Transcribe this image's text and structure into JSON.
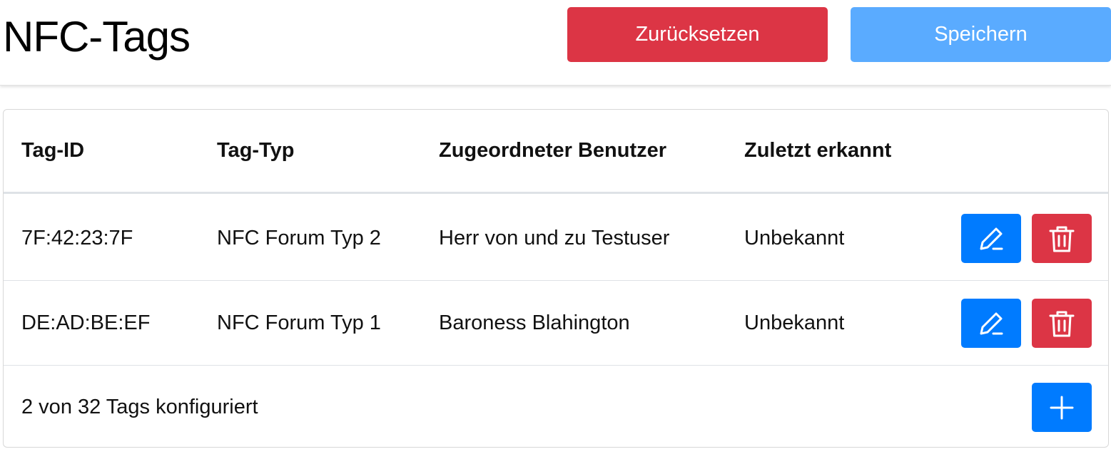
{
  "header": {
    "title": "NFC-Tags",
    "reset_label": "Zurücksetzen",
    "save_label": "Speichern"
  },
  "table": {
    "columns": [
      "Tag-ID",
      "Tag-Typ",
      "Zugeordneter Benutzer",
      "Zuletzt erkannt"
    ],
    "rows": [
      {
        "tag_id": "7F:42:23:7F",
        "tag_type": "NFC Forum Typ 2",
        "user": "Herr von und zu Testuser",
        "last_seen": "Unbekannt"
      },
      {
        "tag_id": "DE:AD:BE:EF",
        "tag_type": "NFC Forum Typ 1",
        "user": "Baroness Blahington",
        "last_seen": "Unbekannt"
      }
    ],
    "footer_text": "2 von 32 Tags konfiguriert"
  },
  "icons": {
    "edit": "pencil-icon",
    "delete": "trash-icon",
    "add": "plus-icon"
  },
  "colors": {
    "danger": "#dc3545",
    "primary": "#007bff",
    "primary_disabled": "#5aabff"
  }
}
